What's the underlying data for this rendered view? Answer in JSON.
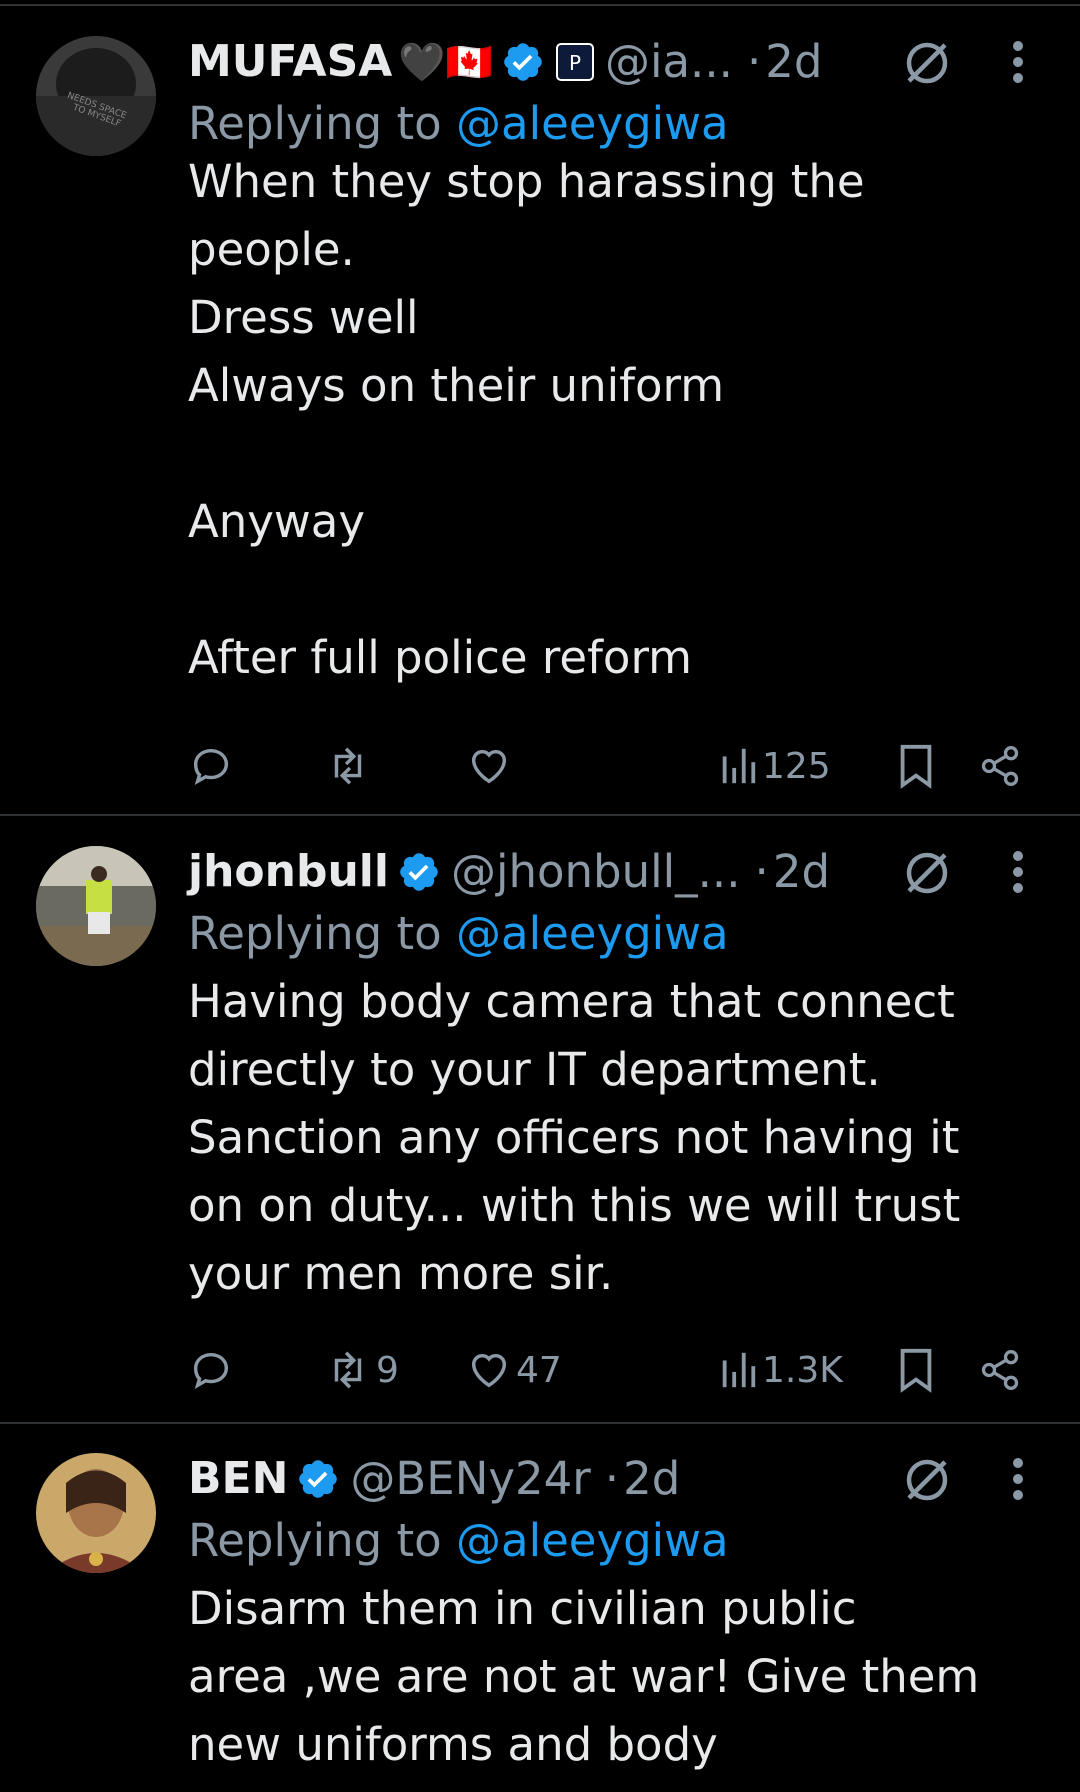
{
  "tweets": [
    {
      "name": "MUFASA",
      "name_suffix": "🖤🇨🇦",
      "handle": "@ia...",
      "time": "2d",
      "replying_prefix": "Replying to",
      "replying_handle": "@aleeygiwa",
      "lines": [
        "When they stop harassing the",
        "people.",
        "Dress well",
        "Always on their uniform",
        "",
        "Anyway",
        "",
        "After full police reform"
      ],
      "replies": "",
      "retweets": "",
      "likes": "",
      "views": "125",
      "avatar_text": "NEEDS SPACE TO MYSELF"
    },
    {
      "name": "jhonbull",
      "handle": "@jhonbull_...",
      "time": "2d",
      "replying_prefix": "Replying to",
      "replying_handle": "@aleeygiwa",
      "lines": [
        "Having body camera that connect",
        "directly to your IT department.",
        "Sanction any officers not having it",
        "on on duty... with this we will trust",
        "your men more sir."
      ],
      "replies": "",
      "retweets": "9",
      "likes": "47",
      "views": "1.3K"
    },
    {
      "name": "BEN",
      "handle": "@BENy24r",
      "time": "2d",
      "replying_prefix": "Replying to",
      "replying_handle": "@aleeygiwa",
      "lines": [
        "Disarm them in civilian public",
        "area ,we are not at war! Give them",
        "new uniforms and body"
      ]
    }
  ],
  "colors": {
    "background": "#000000",
    "text": "#e7e9ea",
    "secondary": "#8b98a5",
    "link": "#1d9bf0",
    "verified": "#1d9bf0"
  },
  "icons": [
    "reply-icon",
    "retweet-icon",
    "like-icon",
    "views-icon",
    "bookmark-icon",
    "share-icon",
    "grok-icon",
    "more-icon",
    "verified-icon"
  ]
}
